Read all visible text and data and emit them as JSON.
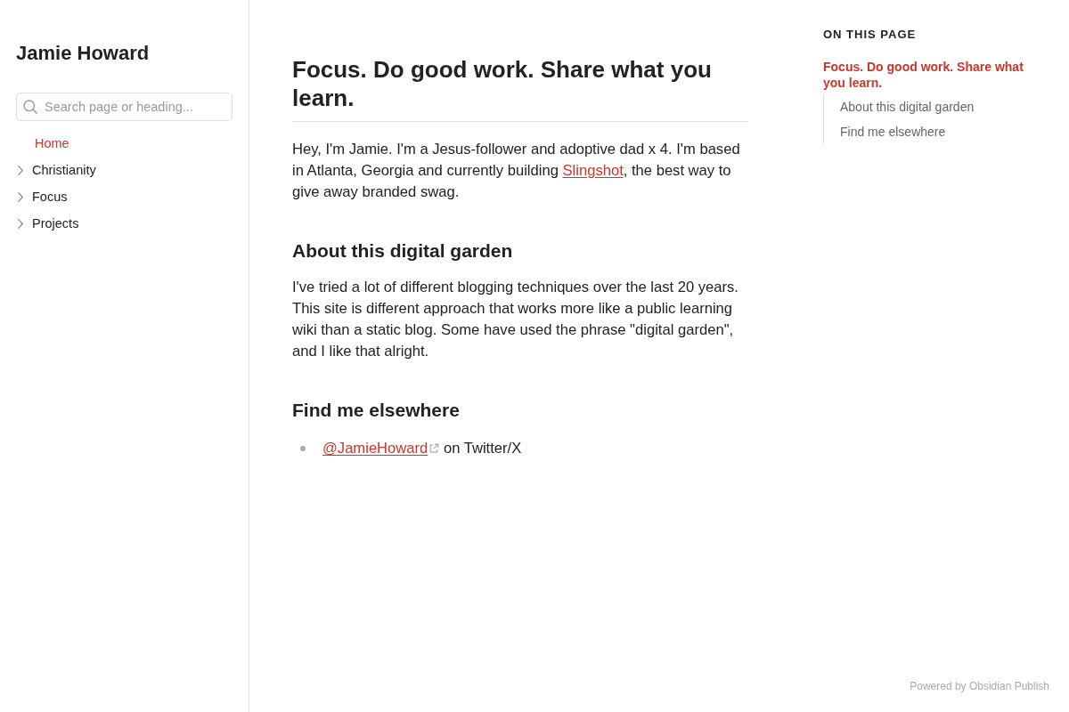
{
  "sidebar": {
    "site_title": "Jamie Howard",
    "search": {
      "placeholder": "Search page or heading..."
    },
    "nav": [
      {
        "kind": "file",
        "label": "Home",
        "selected": true
      },
      {
        "kind": "folder",
        "label": "Christianity",
        "selected": false,
        "expanded": false
      },
      {
        "kind": "folder",
        "label": "Focus",
        "selected": false,
        "expanded": false
      },
      {
        "kind": "folder",
        "label": "Projects",
        "selected": false,
        "expanded": false
      }
    ]
  },
  "article": {
    "title": "Focus. Do good work. Share what you learn.",
    "blocks": [
      {
        "kind": "paragraph",
        "parts": [
          {
            "kind": "text",
            "text": "Hey, I'm Jamie. I'm a Jesus-follower and adoptive dad x 4. I'm based in Atlanta, Georgia and currently building "
          },
          {
            "kind": "link",
            "text": "Slingshot",
            "external": false
          },
          {
            "kind": "text",
            "text": ", the best way to give away branded swag."
          }
        ]
      },
      {
        "kind": "heading",
        "text": "About this digital garden"
      },
      {
        "kind": "paragraph",
        "parts": [
          {
            "kind": "text",
            "text": "I've tried a lot of different blogging techniques over the last 20 years. This site is different approach that works more like a public learning wiki than a static blog. Some have used the phrase \"digital garden\", and I like that alright."
          }
        ]
      },
      {
        "kind": "heading",
        "text": "Find me elsewhere"
      },
      {
        "kind": "list",
        "items": [
          {
            "parts": [
              {
                "kind": "link",
                "text": "@JamieHoward",
                "external": true
              },
              {
                "kind": "text",
                "text": " on Twitter/X"
              }
            ]
          }
        ]
      }
    ]
  },
  "toc": {
    "heading": "ON THIS PAGE",
    "items": [
      {
        "label": "Focus. Do good work. Share what you learn.",
        "selected": true,
        "children": [
          {
            "label": "About this digital garden",
            "selected": false
          },
          {
            "label": "Find me elsewhere",
            "selected": false
          }
        ]
      }
    ]
  },
  "footer": {
    "text": "Powered by Obsidian Publish"
  }
}
